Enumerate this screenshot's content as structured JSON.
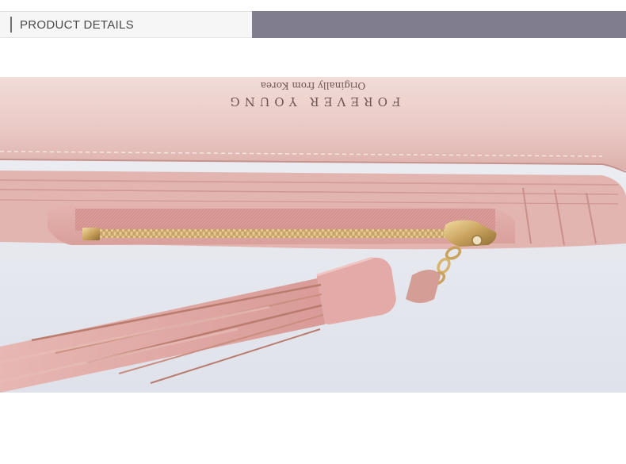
{
  "header": {
    "title": "PRODUCT DETAILS"
  },
  "photo": {
    "brand_text": "FOREVER YOUNG",
    "tagline_text": "Originally from Korea"
  },
  "colors": {
    "header_left_bg": "#f6f6f6",
    "header_right_bg": "#7f7d8e",
    "leather_pink": "#d9a3a1",
    "zipper_gold": "#c9a35e"
  }
}
